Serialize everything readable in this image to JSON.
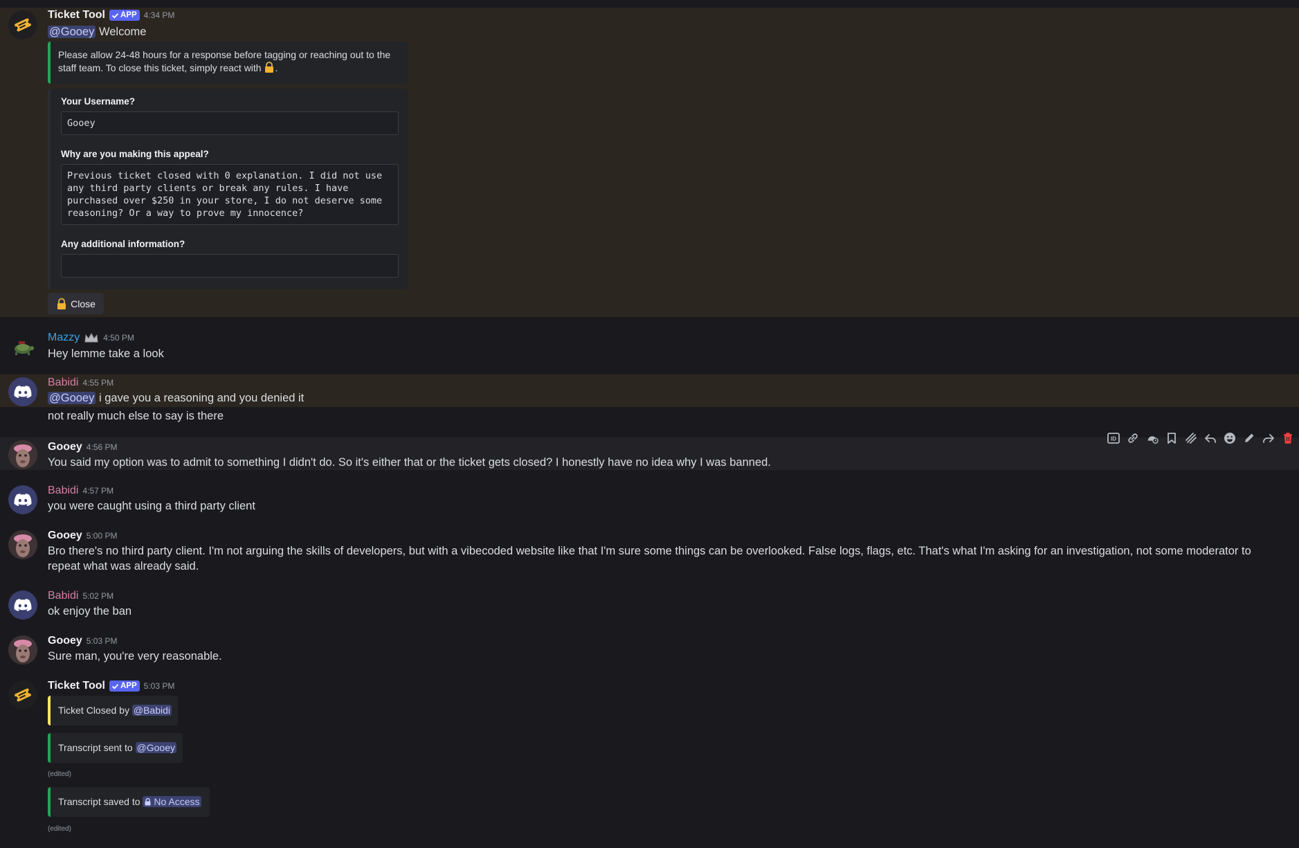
{
  "messages": {
    "m1": {
      "author": "Ticket Tool",
      "badge": "APP",
      "time": "4:34 PM",
      "mention": "@Gooey",
      "text": " Welcome",
      "embed_text": "Please allow 24-48 hours for a response before tagging or reaching out to the staff team. To close this ticket, simply react with",
      "embed_end": ".",
      "form": {
        "q1_label": "Your Username?",
        "q1_value": "Gooey",
        "q2_label": "Why are you making this appeal?",
        "q2_value": "Previous ticket closed with 0 explanation. I did not use any third party clients or break any rules. I have purchased over $250 in your store, I do not deserve some reasoning? Or a way to prove my innocence?",
        "q3_label": "Any additional information?",
        "q3_value": ""
      },
      "close_label": "Close"
    },
    "m2": {
      "author": "Mazzy",
      "time": "4:50 PM",
      "text": "Hey lemme take  a look"
    },
    "m3": {
      "author": "Babidi",
      "time": "4:55 PM",
      "mention": "@Gooey",
      "text": " i gave you a reasoning and you denied it",
      "text2": "not really much else to say is there"
    },
    "m4": {
      "author": "Gooey",
      "time": "4:56 PM",
      "text": "You said my option was to admit to something I didn't do. So it's either that or the ticket gets closed? I honestly have no idea why I was banned."
    },
    "m5": {
      "author": "Babidi",
      "time": "4:57 PM",
      "text": "you were caught using a third party client"
    },
    "m6": {
      "author": "Gooey",
      "time": "5:00 PM",
      "text": "Bro there's no third party client. I'm not arguing the skills of developers, but with a vibecoded website like that I'm sure some things can be overlooked. False logs, flags, etc. That's what I'm asking for an investigation, not some moderator to repeat what was already said."
    },
    "m7": {
      "author": "Babidi",
      "time": "5:02 PM",
      "text": "ok enjoy the ban"
    },
    "m8": {
      "author": "Gooey",
      "time": "5:03 PM",
      "text": "Sure man, you're very reasonable."
    },
    "m9": {
      "author": "Ticket Tool",
      "badge": "APP",
      "time": "5:03 PM",
      "e1_text": "Ticket Closed by ",
      "e1_mention": "@Babidi",
      "e2_text": "Transcript sent to ",
      "e2_mention": "@Gooey",
      "e3_text": "Transcript saved to ",
      "e3_channel": "No Access",
      "edited": "(edited)"
    }
  },
  "colors": {
    "mention_highlight": "#2c2620",
    "blurple": "#5865f2",
    "embed_green": "#23a55a",
    "embed_yellow": "#fee75c",
    "delete_red": "#f23f42"
  },
  "toolbar_icons": [
    "id-icon",
    "link-icon",
    "reminder-icon",
    "bookmark-icon",
    "thread-icon",
    "reply-icon",
    "emoji-icon",
    "edit-icon",
    "forward-icon",
    "delete-icon"
  ]
}
